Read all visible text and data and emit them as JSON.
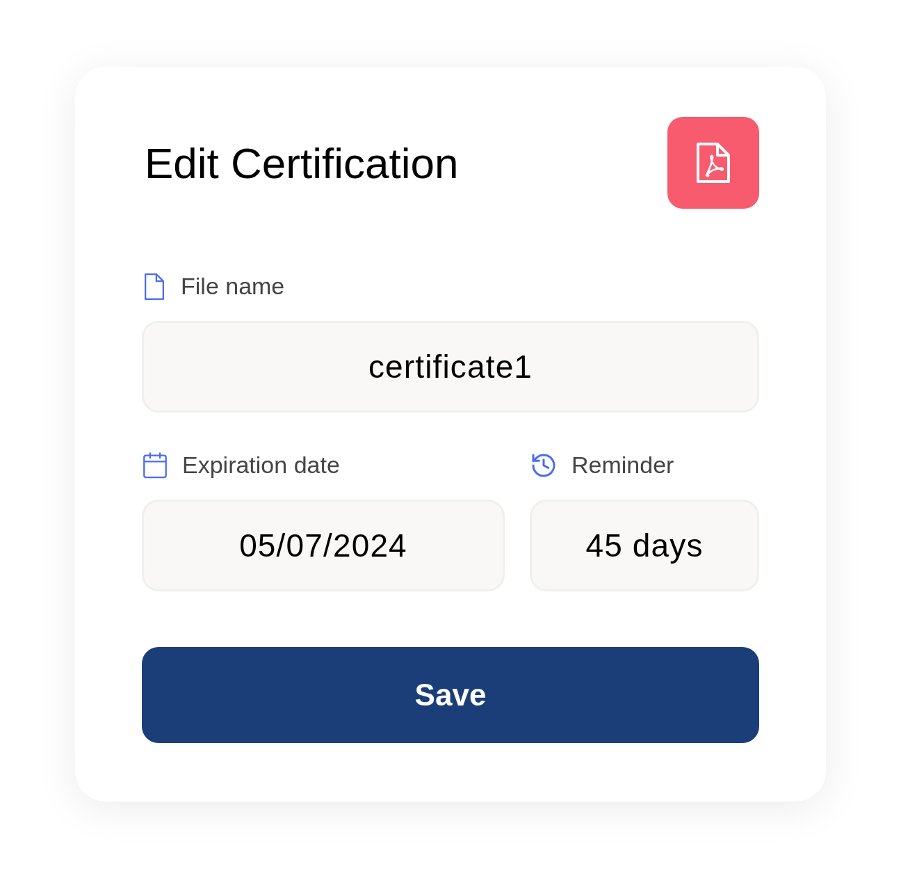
{
  "title": "Edit Certification",
  "file_name": {
    "label": "File name",
    "value": "certificate1"
  },
  "expiration_date": {
    "label": "Expiration date",
    "value": "05/07/2024"
  },
  "reminder": {
    "label": "Reminder",
    "value": "45 days"
  },
  "save_button": {
    "label": "Save"
  }
}
